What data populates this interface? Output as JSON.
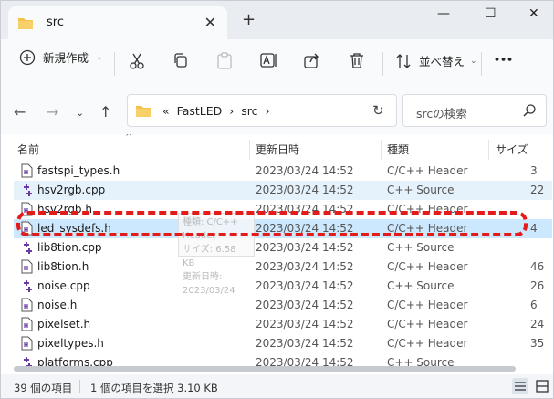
{
  "window": {
    "tab_title": "src",
    "new_tab": "+",
    "min": "—",
    "max": "☐",
    "close": "✕"
  },
  "toolbar": {
    "new_label": "新規作成",
    "sort_label": "並べ替え",
    "more": "•••"
  },
  "address": {
    "prefix": "«",
    "crumbs": [
      "FastLED",
      "src"
    ],
    "sep": "›"
  },
  "search": {
    "placeholder": "srcの検索"
  },
  "columns": {
    "name": "名前",
    "date": "更新日時",
    "type": "種類",
    "size": "サイズ"
  },
  "rows": [
    {
      "name": "fastspi_types.h",
      "date": "2023/03/24 14:52",
      "type": "C/C++ Header",
      "size": "3",
      "icon": "h"
    },
    {
      "name": "hsv2rgb.cpp",
      "date": "2023/03/24 14:52",
      "type": "C++ Source",
      "size": "22",
      "icon": "cpp"
    },
    {
      "name": "hsv2rgb.h",
      "date": "2023/03/24 14:52",
      "type": "C/C++ Header",
      "size": "",
      "icon": "h"
    },
    {
      "name": "led_sysdefs.h",
      "date": "2023/03/24 14:52",
      "type": "C/C++ Header",
      "size": "4",
      "icon": "h"
    },
    {
      "name": "lib8tion.cpp",
      "date": "2023/03/24 14:52",
      "type": "C++ Source",
      "size": "",
      "icon": "cpp"
    },
    {
      "name": "lib8tion.h",
      "date": "2023/03/24 14:52",
      "type": "C/C++ Header",
      "size": "46",
      "icon": "h"
    },
    {
      "name": "noise.cpp",
      "date": "2023/03/24 14:52",
      "type": "C++ Source",
      "size": "26",
      "icon": "cpp"
    },
    {
      "name": "noise.h",
      "date": "2023/03/24 14:52",
      "type": "C/C++ Header",
      "size": "6",
      "icon": "h"
    },
    {
      "name": "pixelset.h",
      "date": "2023/03/24 14:52",
      "type": "C/C++ Header",
      "size": "24",
      "icon": "h"
    },
    {
      "name": "pixeltypes.h",
      "date": "2023/03/24 14:52",
      "type": "C/C++ Header",
      "size": "35",
      "icon": "h"
    },
    {
      "name": "platforms.cpp",
      "date": "2023/03/24 14:52",
      "type": "C++ Source",
      "size": "",
      "icon": "cpp"
    }
  ],
  "tooltip": {
    "line1": "種類: C/C++ Header",
    "line2": "サイズ: 6.58 KB",
    "line3": "更新日時: 2023/03/24"
  },
  "status": {
    "count": "39 個の項目",
    "selection": "1 個の項目を選択  3.10 KB"
  },
  "colors": {
    "folder": "#f2c14e",
    "selected": "#cce8ff",
    "hover": "#e5f1fb",
    "highlight": "#e31b1b",
    "accent": "#0067c0"
  }
}
